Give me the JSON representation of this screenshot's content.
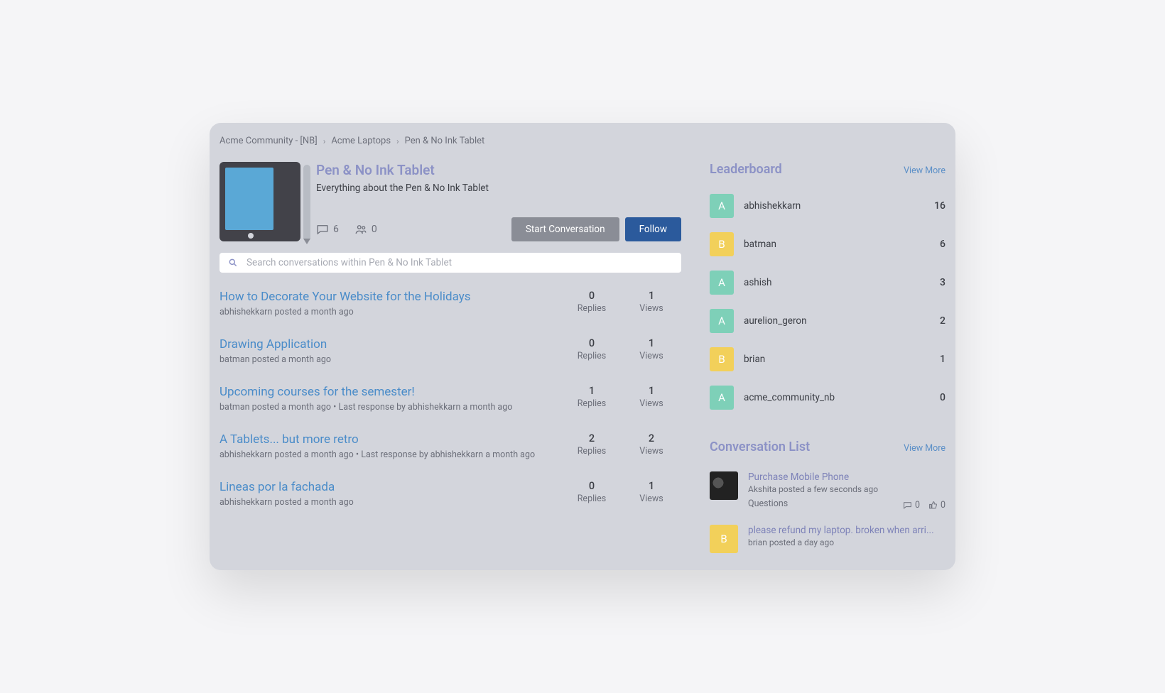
{
  "breadcrumb": [
    "Acme Community - [NB]",
    "Acme Laptops",
    "Pen & No Ink Tablet"
  ],
  "forum": {
    "title": "Pen & No Ink Tablet",
    "description": "Everything about the Pen & No Ink Tablet",
    "conversations_count": "6",
    "members_count": "0"
  },
  "buttons": {
    "start_conversation": "Start Conversation",
    "follow": "Follow"
  },
  "search": {
    "placeholder": "Search conversations within Pen & No Ink Tablet"
  },
  "threads": [
    {
      "title": "How to Decorate Your Website for the Holidays",
      "meta": "abhishekkarn posted a month ago",
      "replies": "0",
      "views": "1"
    },
    {
      "title": "Drawing Application",
      "meta": "batman posted a month ago",
      "replies": "0",
      "views": "1"
    },
    {
      "title": "Upcoming courses for the semester!",
      "meta": "batman posted a month ago • Last response by abhishekkarn a month ago",
      "replies": "1",
      "views": "1"
    },
    {
      "title": "A Tablets... but more retro",
      "meta": "abhishekkarn posted a month ago • Last response by abhishekkarn a month ago",
      "replies": "2",
      "views": "2"
    },
    {
      "title": "Lineas por la fachada",
      "meta": "abhishekkarn posted a month ago",
      "replies": "0",
      "views": "1"
    }
  ],
  "labels": {
    "replies": "Replies",
    "views": "Views"
  },
  "leaderboard": {
    "title": "Leaderboard",
    "view_more": "View More",
    "items": [
      {
        "initial": "A",
        "color": "teal",
        "name": "abhishekkarn",
        "score": "16"
      },
      {
        "initial": "B",
        "color": "yellow",
        "name": "batman",
        "score": "6"
      },
      {
        "initial": "A",
        "color": "teal",
        "name": "ashish",
        "score": "3"
      },
      {
        "initial": "A",
        "color": "teal",
        "name": "aurelion_geron",
        "score": "2"
      },
      {
        "initial": "B",
        "color": "yellow",
        "name": "brian",
        "score": "1"
      },
      {
        "initial": "A",
        "color": "teal",
        "name": "acme_community_nb",
        "score": "0"
      }
    ]
  },
  "conversation_list": {
    "title": "Conversation List",
    "view_more": "View More",
    "items": [
      {
        "title": "Purchase Mobile Phone",
        "meta": "Akshita posted a few seconds ago",
        "category": "Questions",
        "comments": "0",
        "likes": "0",
        "thumb": "image"
      },
      {
        "title": "please refund my laptop. broken when arri...",
        "meta": "brian posted a day ago",
        "initial": "B",
        "color": "yellow"
      }
    ]
  }
}
